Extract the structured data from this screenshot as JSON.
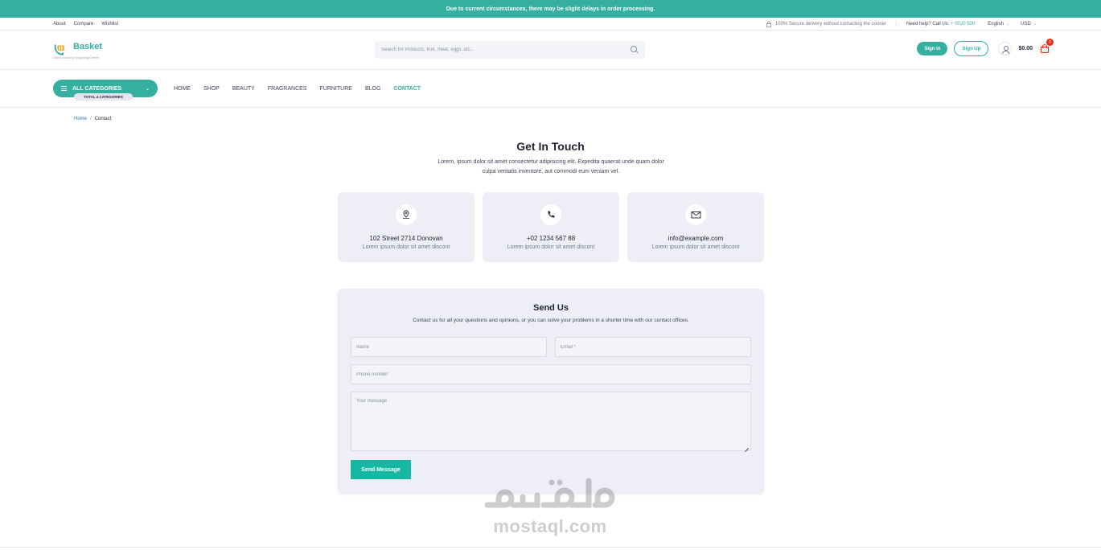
{
  "announcement": "Due to current circumstances, there may be slight delays in order processing.",
  "utility": {
    "links": [
      "About",
      "Compare",
      "Wishlist"
    ],
    "secure_text": "100% Secure delivery without contacting the courier",
    "help_label": "Need help? Call Us:",
    "help_phone": "+ 0020 500",
    "language": "English",
    "currency": "USD"
  },
  "header": {
    "logo_name": "Basket",
    "logo_tagline": "Online Grocery Shopping Center",
    "search_placeholder": "Search for Products, fruit, meat, eggs .etc...",
    "signin_label": "Sign In",
    "signup_label": "Sign Up",
    "cart_total": "$0.00",
    "cart_count": "0",
    "accent": "#35afa0"
  },
  "nav": {
    "all_categories": "ALL CATEGORIES",
    "total_categories": "TOTAL 4 CATEGORIES",
    "links": [
      "HOME",
      "SHOP",
      "BEAUTY",
      "FRAGRANCES",
      "FURNITURE",
      "BLOG",
      "CONTACT"
    ],
    "active": "CONTACT"
  },
  "breadcrumb": {
    "home": "Home",
    "separator": "/",
    "current": "Contact"
  },
  "get_in_touch": {
    "title": "Get In Touch",
    "subtitle": "Lorem, ipsum dolor sit amet consectetur adipisicing elit. Expedita quaerat unde quam dolor culpa veritatis inventore, aut commodi eum veniam vel."
  },
  "cards": [
    {
      "icon": "map-pin-icon",
      "title": "102 Street 2714 Donovan",
      "desc": "Lorem ipsum dolor sit amet discont"
    },
    {
      "icon": "phone-icon",
      "title": "+02 1234 567 88",
      "desc": "Lorem ipsum dolor sit amet discont"
    },
    {
      "icon": "envelope-icon",
      "title": "info@example.com",
      "desc": "Lorem ipsum dolor sit amet discont"
    }
  ],
  "form": {
    "title": "Send Us",
    "subtitle": "Contact us for all your questions and opinions, or you can solve your problems in a shorter time with our contact offices.",
    "name_placeholder": "Name",
    "email_placeholder": "Email *",
    "phone_placeholder": "Phone number",
    "message_placeholder": "Your message",
    "submit_label": "Send Message"
  },
  "watermark": {
    "arabic": "مستقل",
    "latin": "mostaql.com"
  }
}
